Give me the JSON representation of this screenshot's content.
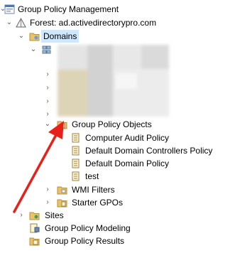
{
  "tree": {
    "root": {
      "label": "Group Policy Management",
      "icon": "gpm-console-icon"
    },
    "forest": {
      "label": "Forest: ad.activedirectorypro.com",
      "icon": "forest-icon"
    },
    "domains": {
      "label": "Domains",
      "icon": "domains-folder-icon"
    },
    "domain_node": {
      "icon": "domain-icon"
    },
    "gpo_folder": {
      "label": "Group Policy Objects",
      "icon": "gpo-folder-icon"
    },
    "gpos": [
      {
        "label": "Computer Audit Policy",
        "icon": "policy-scroll-icon"
      },
      {
        "label": "Default Domain Controllers Policy",
        "icon": "policy-scroll-icon"
      },
      {
        "label": "Default Domain Policy",
        "icon": "policy-scroll-icon"
      },
      {
        "label": "test",
        "icon": "policy-scroll-icon"
      }
    ],
    "wmi_filters": {
      "label": "WMI Filters",
      "icon": "folder-icon"
    },
    "starter_gpos": {
      "label": "Starter GPOs",
      "icon": "folder-icon"
    },
    "sites": {
      "label": "Sites",
      "icon": "sites-icon"
    },
    "modeling": {
      "label": "Group Policy Modeling",
      "icon": "modeling-icon"
    },
    "results": {
      "label": "Group Policy Results",
      "icon": "results-icon"
    }
  },
  "colors": {
    "selection": "#cde8ff",
    "annotation_arrow": "#e8201a",
    "folder": "#e8c36a"
  }
}
